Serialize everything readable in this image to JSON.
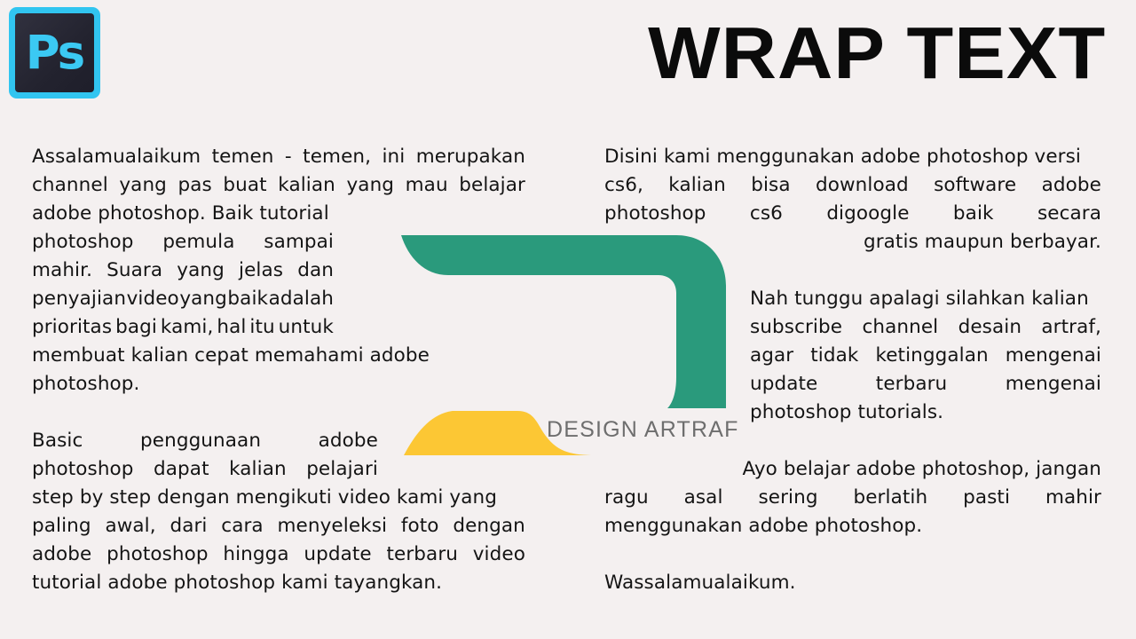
{
  "brand": {
    "app_icon_label": "Ps",
    "accent_blue": "#31C5F0",
    "icon_dark": "#2A2A38"
  },
  "header": {
    "title": "WRAP TEXT"
  },
  "watermark": {
    "text": "DESIGN ARTRAF",
    "color": "#6E6E6E"
  },
  "canvas": {
    "background": "#F4F0F0",
    "text_color": "#141414"
  },
  "shapes": {
    "green": {
      "name": "green-bracket-shape",
      "color": "#2A9A7C"
    },
    "yellow": {
      "name": "yellow-blob-shape",
      "color": "#FCC734"
    }
  },
  "left_column": {
    "paragraph_1": {
      "full_text": "Assalamualaikum temen - temen, ini merupakan channel yang pas buat kalian yang mau belajar adobe photoshop. Baik tutorial photoshop pemula sampai mahir. Suara yang jelas dan penyajian video yang baik adalah prioritas bagi kami, hal itu untuk membuat kalian cepat memahami adobe photoshop.",
      "lines": [
        {
          "words": [
            "Assalamualaikum",
            "temen",
            "-",
            "temen,",
            "ini",
            "merupakan"
          ],
          "justify": true
        },
        {
          "words": [
            "channel",
            "yang",
            "pas",
            "buat",
            "kalian",
            "yang",
            "mau",
            "belajar"
          ],
          "justify": true
        },
        {
          "words": [
            "adobe photoshop. Baik tutorial"
          ],
          "justify": false
        },
        {
          "words": [
            "photoshop",
            "pemula",
            "sampai"
          ],
          "justify": true
        },
        {
          "words": [
            "mahir.",
            "Suara",
            "yang",
            "jelas",
            "dan"
          ],
          "justify": true
        },
        {
          "words": [
            "penyajian",
            "video",
            "yang",
            "baik",
            "adalah"
          ],
          "justify": true
        },
        {
          "words": [
            "prioritas",
            "bagi",
            "kami,",
            "hal",
            "itu",
            "untuk"
          ],
          "justify": true
        },
        {
          "words": [
            "membuat kalian cepat memahami adobe"
          ],
          "justify": false
        },
        {
          "words": [
            "photoshop."
          ],
          "justify": false
        }
      ]
    },
    "paragraph_2": {
      "full_text": "Basic penggunaan adobe photoshop dapat kalian pelajari step by step dengan mengikuti video kami yang paling awal, dari cara menyeleksi foto dengan adobe photoshop hingga update terbaru video tutorial adobe photoshop kami tayangkan.",
      "lines": [
        {
          "words": [
            "Basic",
            "penggunaan",
            "adobe"
          ],
          "justify": true
        },
        {
          "words": [
            "photoshop",
            "dapat",
            "kalian",
            "pelajari"
          ],
          "justify": true
        },
        {
          "words": [
            "step by step dengan mengikuti video kami yang"
          ],
          "justify": false
        },
        {
          "words": [
            "paling",
            "awal,",
            "dari",
            "cara",
            "menyeleksi",
            "foto",
            "dengan"
          ],
          "justify": true
        },
        {
          "words": [
            "adobe",
            "photoshop",
            "hingga",
            "update",
            "terbaru",
            "video"
          ],
          "justify": true
        },
        {
          "words": [
            "tutorial adobe photoshop kami tayangkan."
          ],
          "justify": false
        }
      ]
    }
  },
  "right_column": {
    "paragraph_1": {
      "full_text": "Disini kami menggunakan adobe photoshop versi cs6, kalian bisa download software adobe photoshop cs6 digoogle baik secara gratis maupun berbayar.",
      "lines": [
        {
          "words": [
            "Disini kami menggunakan adobe photoshop versi"
          ],
          "justify": false
        },
        {
          "words": [
            "cs6,",
            "kalian",
            "bisa",
            "download",
            "software",
            "adobe"
          ],
          "justify": true
        },
        {
          "words": [
            "photoshop",
            "cs6",
            "digoogle",
            "baik",
            "secara"
          ],
          "justify": true
        },
        {
          "words": [
            "gratis maupun berbayar."
          ],
          "justify": false
        }
      ]
    },
    "paragraph_2": {
      "full_text": "Nah tunggu apalagi silahkan kalian subscribe channel desain artraf, agar tidak ketinggalan mengenai update terbaru mengenai photoshop tutorials.",
      "lines": [
        {
          "words": [
            "Nah tunggu apalagi silahkan kalian"
          ],
          "justify": false
        },
        {
          "words": [
            "subscribe",
            "channel",
            "desain",
            "artraf,"
          ],
          "justify": true
        },
        {
          "words": [
            "agar",
            "tidak",
            "ketinggalan",
            "mengenai"
          ],
          "justify": true
        },
        {
          "words": [
            "update",
            "terbaru",
            "mengenai"
          ],
          "justify": true
        },
        {
          "words": [
            "photoshop tutorials."
          ],
          "justify": false
        }
      ]
    },
    "paragraph_3": {
      "full_text": "Ayo belajar adobe photoshop, jangan ragu asal sering berlatih pasti mahir menggunakan adobe photoshop.",
      "lines": [
        {
          "words": [
            "Ayo belajar adobe photoshop, jangan"
          ],
          "justify": false
        },
        {
          "words": [
            "ragu",
            "asal",
            "sering",
            "berlatih",
            "pasti",
            "mahir"
          ],
          "justify": true
        },
        {
          "words": [
            "menggunakan adobe photoshop."
          ],
          "justify": false
        }
      ]
    },
    "paragraph_4": {
      "full_text": "Wassalamualaikum.",
      "lines": [
        {
          "words": [
            "Wassalamualaikum."
          ],
          "justify": false
        }
      ]
    }
  }
}
